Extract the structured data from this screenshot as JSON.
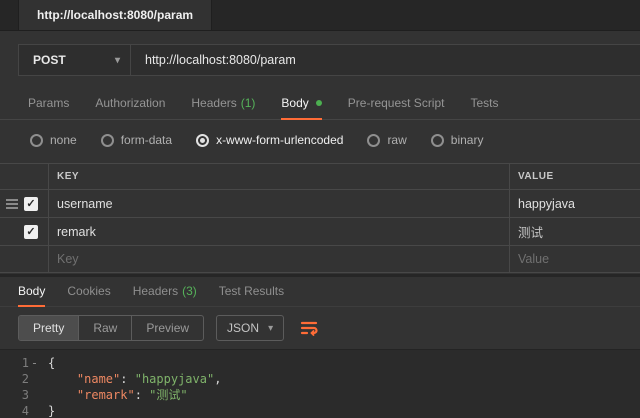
{
  "icons": {
    "chevron_down": "▾",
    "check": "✓"
  },
  "colors": {
    "accent": "#ff6c37",
    "success_green": "#4caf50"
  },
  "app_tab": {
    "title": "http://localhost:8080/param"
  },
  "request": {
    "method": "POST",
    "url": "http://localhost:8080/param"
  },
  "request_tabs": {
    "params": "Params",
    "authorization": "Authorization",
    "headers_label": "Headers",
    "headers_count": "(1)",
    "body": "Body",
    "pre_request": "Pre-request Script",
    "tests": "Tests"
  },
  "body_modes": {
    "none": "none",
    "form_data": "form-data",
    "urlencoded": "x-www-form-urlencoded",
    "raw": "raw",
    "binary": "binary"
  },
  "kv_table": {
    "key_header": "KEY",
    "value_header": "VALUE",
    "rows": [
      {
        "key": "username",
        "value": "happyjava"
      },
      {
        "key": "remark",
        "value": "测试"
      }
    ],
    "placeholder": {
      "key": "Key",
      "value": "Value"
    }
  },
  "response_tabs": {
    "body": "Body",
    "cookies": "Cookies",
    "headers_label": "Headers",
    "headers_count": "(3)",
    "test_results": "Test Results"
  },
  "response_toolbar": {
    "pretty": "Pretty",
    "raw": "Raw",
    "preview": "Preview",
    "format": "JSON"
  },
  "response_body": {
    "line_numbers": [
      "1",
      "2",
      "3",
      "4"
    ],
    "fold_marker": "-",
    "indent": "    ",
    "l1": "{",
    "l2": {
      "key": "\"name\"",
      "sep": ": ",
      "value": "\"happyjava\"",
      "comma": ","
    },
    "l3": {
      "key": "\"remark\"",
      "sep": ": ",
      "value": "\"测试\""
    },
    "l4": "}"
  }
}
